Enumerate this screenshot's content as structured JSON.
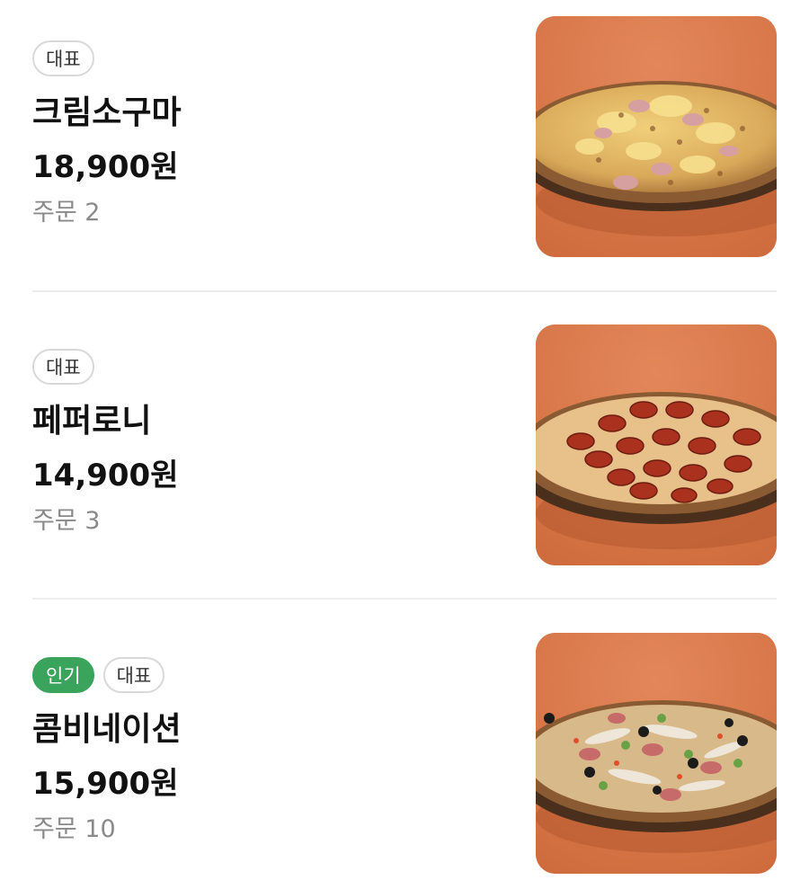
{
  "colors": {
    "thumbnail_background": "#d9784a",
    "badge_popular": "#3aa35c",
    "badge_outline": "#d9d9d9",
    "order_text": "#8a8a8a"
  },
  "menu": {
    "items": [
      {
        "badges": [
          {
            "label": "대표",
            "style": "outline"
          }
        ],
        "name": "크림소구마",
        "price": "18,900원",
        "orders": "주문 2",
        "image": "cream-sweet-potato-pizza-photo"
      },
      {
        "badges": [
          {
            "label": "대표",
            "style": "outline"
          }
        ],
        "name": "페퍼로니",
        "price": "14,900원",
        "orders": "주문 3",
        "image": "pepperoni-pizza-photo"
      },
      {
        "badges": [
          {
            "label": "인기",
            "style": "green"
          },
          {
            "label": "대표",
            "style": "outline"
          }
        ],
        "name": "콤비네이션",
        "price": "15,900원",
        "orders": "주문 10",
        "image": "combination-pizza-photo"
      }
    ]
  }
}
